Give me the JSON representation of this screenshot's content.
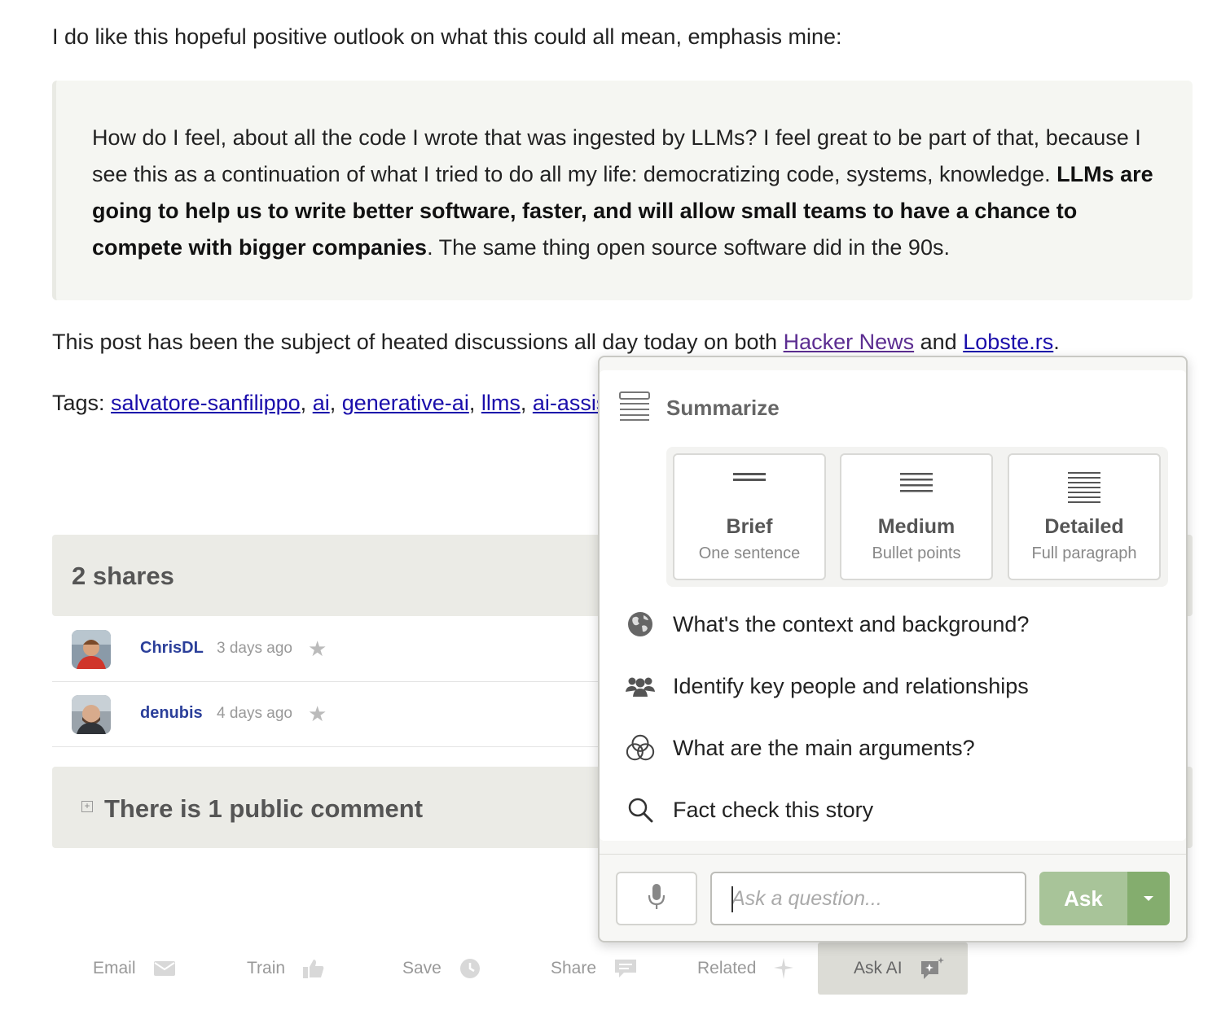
{
  "article": {
    "intro": "I do like this hopeful positive outlook on what this could all mean, emphasis mine:",
    "quote_part1": "How do I feel, about all the code I wrote that was ingested by LLMs? I feel great to be part of that, because I see this as a continuation of what I tried to do all my life: democratizing code, systems, knowledge. ",
    "quote_bold": "LLMs are going to help us to write better software, faster, and will allow small teams to have a chance to compete with bigger companies",
    "quote_part2": ". The same thing open source software did in the 90s.",
    "discussion_prefix": "This post has been the subject of heated discussions all day today on both ",
    "discussion_link1": "Hacker News",
    "discussion_and": " and ",
    "discussion_link2": "Lobste.rs",
    "discussion_suffix": ".",
    "tags_label": "Tags: ",
    "tags": [
      "salvatore-sanfilippo",
      "ai",
      "generative-ai",
      "llms",
      "ai-assisted"
    ]
  },
  "shares": {
    "title": "2 shares",
    "items": [
      {
        "user": "ChrisDL",
        "time": "3 days ago"
      },
      {
        "user": "denubis",
        "time": "4 days ago"
      }
    ]
  },
  "comments": {
    "title": "There is 1 public comment",
    "toggle": "+"
  },
  "actions": [
    {
      "label": "Email",
      "icon": "envelope-icon"
    },
    {
      "label": "Train",
      "icon": "thumbs-up-icon"
    },
    {
      "label": "Save",
      "icon": "clock-icon"
    },
    {
      "label": "Share",
      "icon": "comment-icon"
    },
    {
      "label": "Related",
      "icon": "sparkle-icon"
    },
    {
      "label": "Ask AI",
      "icon": "ai-chat-icon"
    }
  ],
  "ask_ai": {
    "summarize_title": "Summarize",
    "levels": [
      {
        "name": "Brief",
        "desc": "One sentence"
      },
      {
        "name": "Medium",
        "desc": "Bullet points"
      },
      {
        "name": "Detailed",
        "desc": "Full paragraph"
      }
    ],
    "questions": [
      {
        "label": "What's the context and background?",
        "icon": "globe-icon"
      },
      {
        "label": "Identify key people and relationships",
        "icon": "people-icon"
      },
      {
        "label": "What are the main arguments?",
        "icon": "circles-icon"
      },
      {
        "label": "Fact check this story",
        "icon": "search-icon"
      }
    ],
    "input_placeholder": "Ask a question...",
    "ask_label": "Ask"
  },
  "colors": {
    "link": "#1a0dab",
    "ask_button": "#a8c499",
    "ask_dropdown": "#84ad6e",
    "header_bg": "#ebebe6"
  }
}
